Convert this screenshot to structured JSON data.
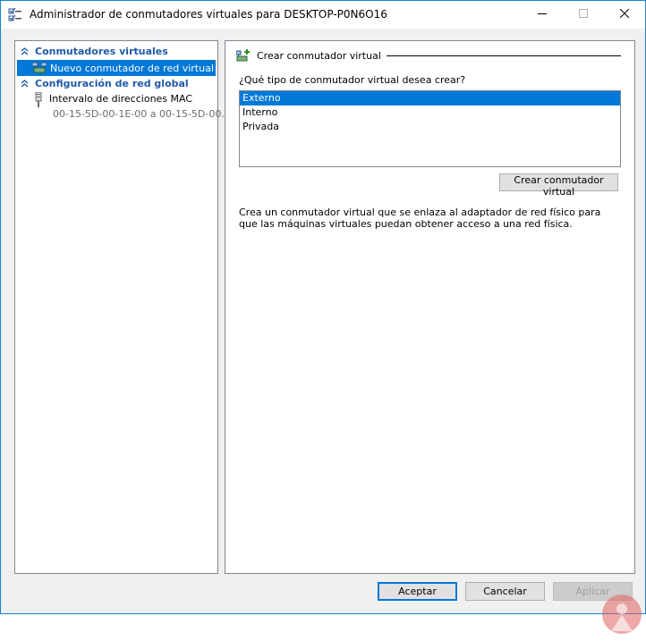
{
  "window": {
    "title": "Administrador de conmutadores virtuales para DESKTOP-P0N6O16",
    "icon": "virtual-switch-manager-icon",
    "controls": [
      "minimize-icon",
      "maximize-icon",
      "close-icon"
    ]
  },
  "sidebar": {
    "sections": [
      {
        "label": "Conmutadores virtuales",
        "icon": "collapse-chevron-icon",
        "items": [
          {
            "label": "Nuevo conmutador de red virtual",
            "icon": "new-virtual-switch-icon",
            "selected": true
          }
        ]
      },
      {
        "label": "Configuración de red global",
        "icon": "collapse-chevron-icon",
        "items": [
          {
            "label": "Intervalo de direcciones MAC",
            "detail": "00-15-5D-00-1E-00 a 00-15-5D-00...",
            "icon": "mac-address-icon"
          }
        ]
      }
    ]
  },
  "main": {
    "group_title": "Crear conmutador virtual",
    "group_icon": "create-switch-icon",
    "question": "¿Qué tipo de conmutador virtual desea crear?",
    "switch_types": [
      {
        "label": "Externo",
        "selected": true
      },
      {
        "label": "Interno",
        "selected": false
      },
      {
        "label": "Privada",
        "selected": false
      }
    ],
    "create_button": "Crear conmutador virtual",
    "description": "Crea un conmutador virtual que se enlaza al adaptador de red físico para que las máquinas virtuales puedan obtener acceso a una red física."
  },
  "footer": {
    "ok_label": "Aceptar",
    "cancel_label": "Cancelar",
    "apply_label": "Aplicar",
    "apply_enabled": false
  },
  "colors": {
    "selection": "#0078d7",
    "section_header": "#1f5aa8",
    "window_border": "#1883d7",
    "background": "#f0f0f0"
  }
}
